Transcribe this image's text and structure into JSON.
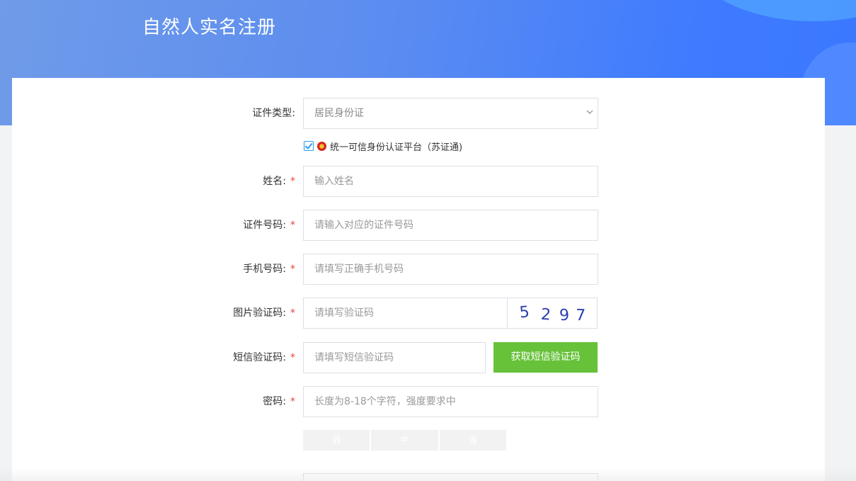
{
  "header": {
    "title": "自然人实名注册"
  },
  "form": {
    "id_type": {
      "label": "证件类型:",
      "value": "居民身份证"
    },
    "platform_check": {
      "label": "统一可信身份认证平台（苏证通)",
      "checked": true
    },
    "name": {
      "label": "姓名:",
      "required_mark": "*",
      "placeholder": "输入姓名"
    },
    "id_number": {
      "label": "证件号码:",
      "required_mark": "*",
      "placeholder": "请输入对应的证件号码"
    },
    "phone": {
      "label": "手机号码:",
      "required_mark": "*",
      "placeholder": "请填写正确手机号码"
    },
    "captcha": {
      "label": "图片验证码:",
      "required_mark": "*",
      "placeholder": "请填写验证码",
      "image_text": "5297"
    },
    "sms_code": {
      "label": "短信验证码:",
      "required_mark": "*",
      "placeholder": "请填写短信验证码",
      "button_label": "获取短信验证码"
    },
    "password": {
      "label": "密码:",
      "required_mark": "*",
      "placeholder": "长度为8-18个字符，强度要求中",
      "strength_levels": [
        "弱",
        "中",
        "强"
      ]
    }
  },
  "colors": {
    "header_gradient_start": "#6f9be8",
    "header_gradient_end": "#3a78ff",
    "primary_green": "#67c23a",
    "required_red": "#e8453c",
    "checkbox_blue": "#2b9cf2"
  }
}
